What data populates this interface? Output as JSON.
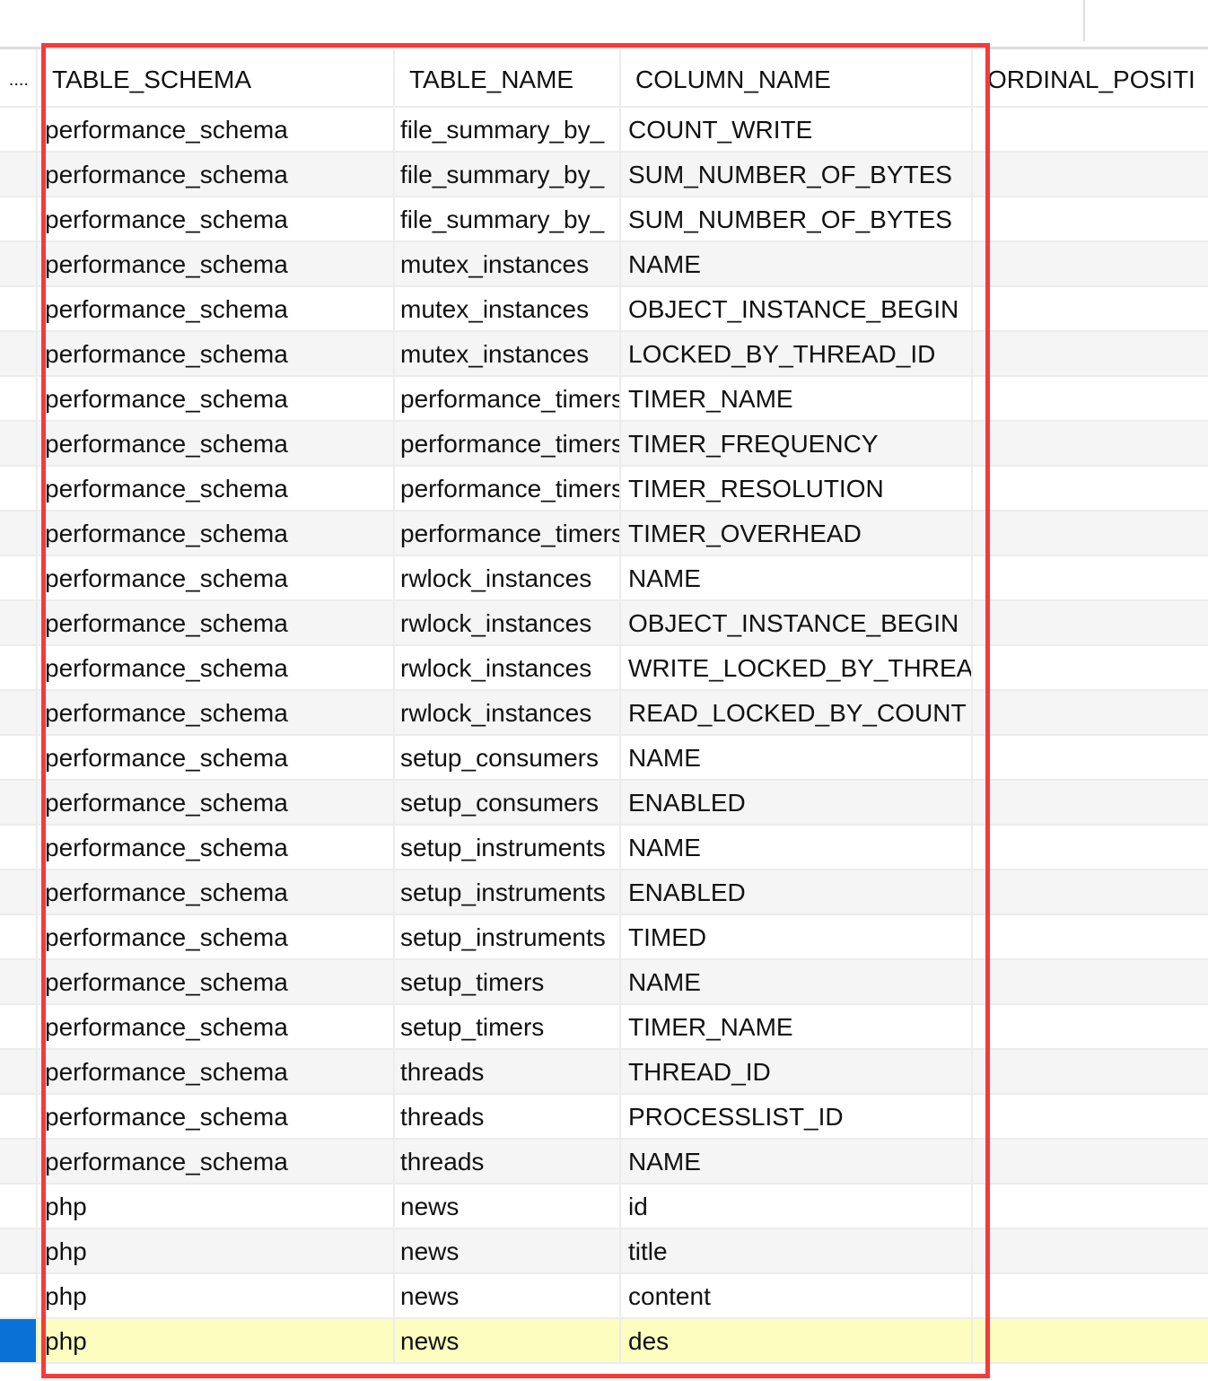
{
  "columns": {
    "rownum": "....",
    "schema": "TABLE_SCHEMA",
    "table": "TABLE_NAME",
    "column": "COLUMN_NAME",
    "ordinal": "ORDINAL_POSITI"
  },
  "rows": [
    [
      "performance_schema",
      "file_summary_by_",
      "COUNT_WRITE"
    ],
    [
      "performance_schema",
      "file_summary_by_",
      "SUM_NUMBER_OF_BYTES"
    ],
    [
      "performance_schema",
      "file_summary_by_",
      "SUM_NUMBER_OF_BYTES"
    ],
    [
      "performance_schema",
      "mutex_instances",
      "NAME"
    ],
    [
      "performance_schema",
      "mutex_instances",
      "OBJECT_INSTANCE_BEGIN"
    ],
    [
      "performance_schema",
      "mutex_instances",
      "LOCKED_BY_THREAD_ID"
    ],
    [
      "performance_schema",
      "performance_timers",
      "TIMER_NAME"
    ],
    [
      "performance_schema",
      "performance_timers",
      "TIMER_FREQUENCY"
    ],
    [
      "performance_schema",
      "performance_timers",
      "TIMER_RESOLUTION"
    ],
    [
      "performance_schema",
      "performance_timers",
      "TIMER_OVERHEAD"
    ],
    [
      "performance_schema",
      "rwlock_instances",
      "NAME"
    ],
    [
      "performance_schema",
      "rwlock_instances",
      "OBJECT_INSTANCE_BEGIN"
    ],
    [
      "performance_schema",
      "rwlock_instances",
      "WRITE_LOCKED_BY_THREAD_ID"
    ],
    [
      "performance_schema",
      "rwlock_instances",
      "READ_LOCKED_BY_COUNT"
    ],
    [
      "performance_schema",
      "setup_consumers",
      "NAME"
    ],
    [
      "performance_schema",
      "setup_consumers",
      "ENABLED"
    ],
    [
      "performance_schema",
      "setup_instruments",
      "NAME"
    ],
    [
      "performance_schema",
      "setup_instruments",
      "ENABLED"
    ],
    [
      "performance_schema",
      "setup_instruments",
      "TIMED"
    ],
    [
      "performance_schema",
      "setup_timers",
      "NAME"
    ],
    [
      "performance_schema",
      "setup_timers",
      "TIMER_NAME"
    ],
    [
      "performance_schema",
      "threads",
      "THREAD_ID"
    ],
    [
      "performance_schema",
      "threads",
      "PROCESSLIST_ID"
    ],
    [
      "performance_schema",
      "threads",
      "NAME"
    ],
    [
      "php",
      "news",
      "id"
    ],
    [
      "php",
      "news",
      "title"
    ],
    [
      "php",
      "news",
      "content"
    ],
    [
      "php",
      "news",
      "des"
    ]
  ],
  "selected_row": 27,
  "highlight_color": "#f53a3a"
}
